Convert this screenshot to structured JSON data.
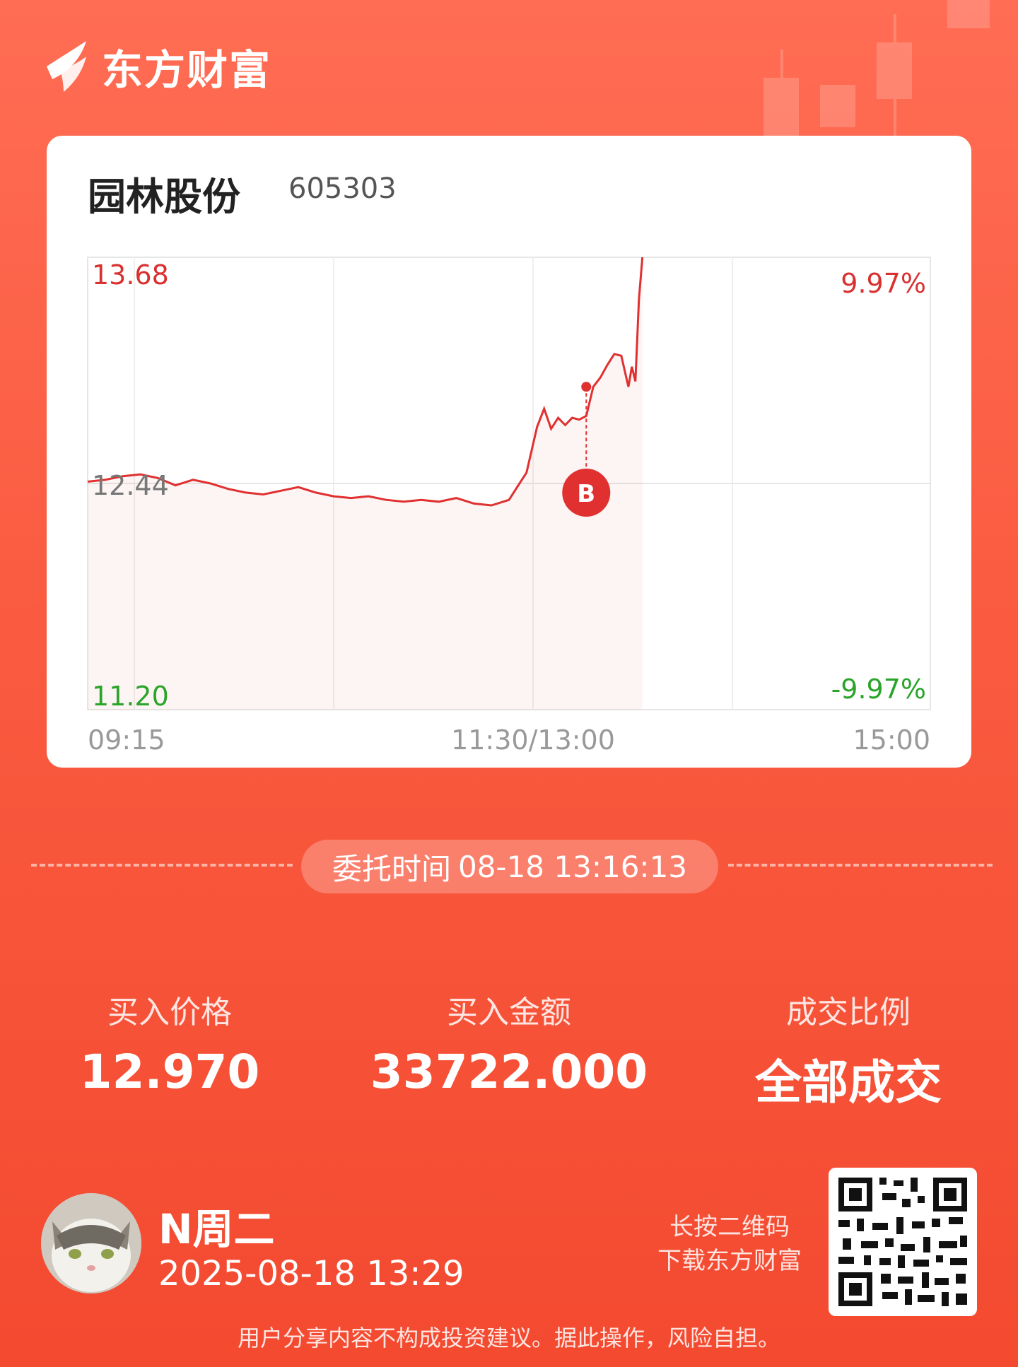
{
  "brand": {
    "name": "东方财富"
  },
  "stock": {
    "name": "园林股份",
    "code": "605303"
  },
  "chart_data": {
    "type": "line",
    "y_max_label": "13.68",
    "y_mid_label": "12.44",
    "y_min_label": "11.20",
    "pct_top_label": "9.97%",
    "pct_bottom_label": "-9.97%",
    "x_labels": [
      "09:15",
      "11:30/13:00",
      "15:00"
    ],
    "ylim": [
      11.2,
      13.68
    ],
    "prev_close": 12.44,
    "x_range_minutes": [
      0,
      240
    ],
    "x": [
      0,
      5,
      10,
      15,
      20,
      25,
      30,
      35,
      40,
      45,
      50,
      55,
      60,
      65,
      70,
      75,
      80,
      85,
      90,
      95,
      100,
      105,
      110,
      115,
      120,
      122,
      125,
      128,
      130,
      132,
      134,
      136,
      138,
      140,
      142,
      144,
      146,
      148,
      150,
      152,
      154,
      155,
      156,
      157,
      158
    ],
    "y": [
      12.45,
      12.46,
      12.48,
      12.49,
      12.47,
      12.43,
      12.46,
      12.44,
      12.41,
      12.39,
      12.38,
      12.4,
      12.42,
      12.39,
      12.37,
      12.36,
      12.37,
      12.35,
      12.34,
      12.35,
      12.34,
      12.36,
      12.33,
      12.32,
      12.35,
      12.41,
      12.5,
      12.75,
      12.85,
      12.74,
      12.8,
      12.76,
      12.8,
      12.79,
      12.81,
      12.97,
      13.02,
      13.09,
      13.15,
      13.14,
      12.97,
      13.08,
      13.0,
      13.45,
      13.68
    ],
    "marker": {
      "label": "B",
      "x": 142,
      "y": 12.97
    }
  },
  "order": {
    "label": "委托时间",
    "time": "08-18 13:16:13"
  },
  "stats": [
    {
      "label": "买入价格",
      "value": "12.970"
    },
    {
      "label": "买入金额",
      "value": "33722.000"
    },
    {
      "label": "成交比例",
      "value": "全部成交"
    }
  ],
  "user": {
    "name": "N周二",
    "time": "2025-08-18 13:29"
  },
  "qr": {
    "line1": "长按二维码",
    "line2": "下载东方财富"
  },
  "footer": "用户分享内容不构成投资建议。据此操作，风险自担。",
  "colors": {
    "up": "#E03030",
    "down": "#2AA52A",
    "accent": "#FA5B40"
  }
}
